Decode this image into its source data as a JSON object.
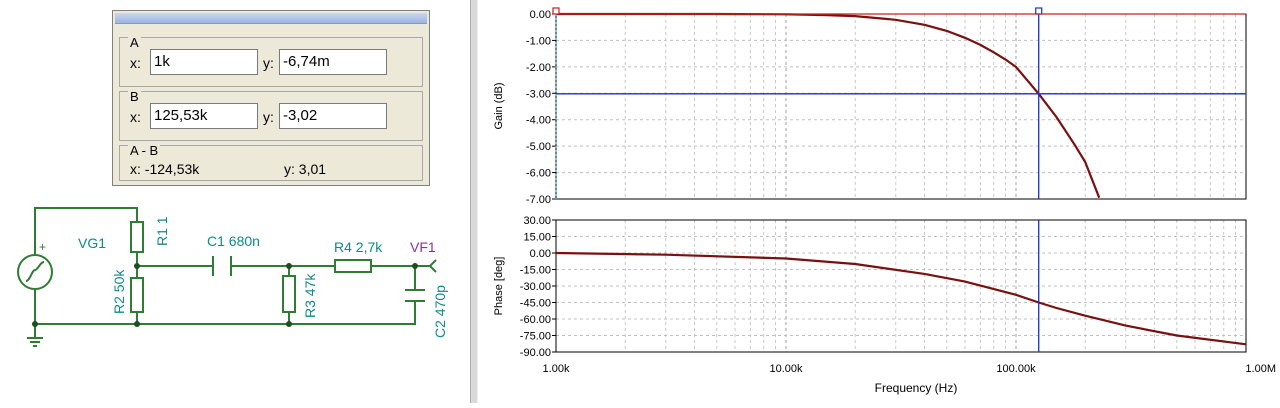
{
  "cursor_panel": {
    "cursor_a": {
      "title": "A",
      "x_label": "x:",
      "x_value": "1k",
      "y_label": "y:",
      "y_value": "-6,74m"
    },
    "cursor_b": {
      "title": "B",
      "x_label": "x:",
      "x_value": "125,53k",
      "y_label": "y:",
      "y_value": "-3,02"
    },
    "difference": {
      "title": "A - B",
      "x_text": "x:  -124,53k",
      "y_text": "y: 3,01"
    }
  },
  "schematic": {
    "labels": {
      "vg1": "VG1",
      "r1": "R1 1",
      "r2": "R2 50k",
      "c1": "C1 680n",
      "r3": "R3 47k",
      "r4": "R4 2,7k",
      "vf1": "VF1",
      "c2": "C2 470p",
      "plus": "+"
    },
    "colors": {
      "wire": "#2e7d32",
      "label": "#0e8a8a",
      "probe": "#8b2fa8"
    }
  },
  "chart_data": [
    {
      "type": "line",
      "title": "",
      "xlabel": "",
      "ylabel": "Gain (dB)",
      "x_scale": "log",
      "xlim": [
        1000,
        1000000
      ],
      "ylim": [
        -7,
        0
      ],
      "yticks": [
        "0.00",
        "-1.00",
        "-2.00",
        "-3.00",
        "-4.00",
        "-5.00",
        "-6.00",
        "-7.00"
      ],
      "grid": true,
      "series": [
        {
          "color": "#7a1010",
          "x": [
            1000,
            5000,
            10000,
            15000,
            20000,
            30000,
            40000,
            50000,
            60000,
            70000,
            80000,
            90000,
            100000,
            125530,
            150000,
            180000,
            200000,
            230000
          ],
          "y": [
            0,
            0,
            -0.01,
            -0.04,
            -0.08,
            -0.22,
            -0.41,
            -0.64,
            -0.9,
            -1.17,
            -1.45,
            -1.72,
            -2.0,
            -3.02,
            -3.9,
            -4.95,
            -5.6,
            -6.95
          ]
        }
      ],
      "cursors": {
        "a_x": 1000,
        "b_x": 125530,
        "b_y": -3.02
      },
      "colors": {
        "cursor_a": "#cc2020",
        "cursor_b": "#1a2fd0"
      }
    },
    {
      "type": "line",
      "title": "",
      "xlabel": "Frequency (Hz)",
      "ylabel": "Phase [deg]",
      "x_scale": "log",
      "xlim": [
        1000,
        1000000
      ],
      "ylim": [
        -90,
        30
      ],
      "yticks": [
        "30.00",
        "15.00",
        "0.00",
        "-15.00",
        "-30.00",
        "-45.00",
        "-60.00",
        "-75.00",
        "-90.00"
      ],
      "xticks": [
        "1.00k",
        "10.00k",
        "100.00k",
        "1.00M"
      ],
      "grid": true,
      "series": [
        {
          "color": "#7a1010",
          "x": [
            1000,
            3000,
            10000,
            20000,
            40000,
            60000,
            100000,
            125530,
            150000,
            200000,
            300000,
            500000,
            1000000
          ],
          "y": [
            0,
            -1.5,
            -5,
            -10,
            -19,
            -26,
            -38,
            -45,
            -50,
            -57,
            -66,
            -75,
            -83
          ]
        }
      ],
      "cursors": {
        "b_x": 125530
      }
    }
  ]
}
